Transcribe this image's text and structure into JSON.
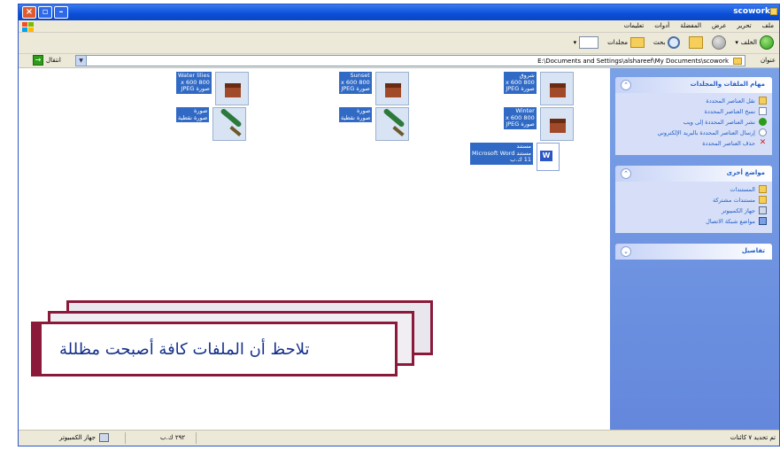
{
  "window": {
    "title": "scowork",
    "controls": {
      "close": "×",
      "maximize": "▫",
      "minimize": "–"
    }
  },
  "menubar": {
    "items": [
      "ملف",
      "تحرير",
      "عرض",
      "المفضلة",
      "أدوات",
      "تعليمات"
    ]
  },
  "toolbar": {
    "back_label": "الخلف",
    "search_label": "بحث",
    "folders_label": "مجلدات",
    "views_icon": "views-icon"
  },
  "addressbar": {
    "label": "عنوان",
    "path": "E:\\Documents and Settings\\alshareef\\My Documents\\scowork",
    "go_label": "انتقال"
  },
  "sidebar": {
    "file_tasks": {
      "title": "مهام الملفات والمجلدات",
      "items": [
        "نقل العناصر المحددة",
        "نسخ العناصر المحددة",
        "نشر العناصر المحددة إلى ويب",
        "إرسال العناصر المحددة بالبريد الإلكتروني",
        "حذف العناصر المحددة"
      ]
    },
    "other_places": {
      "title": "مواضع أخرى",
      "items": [
        "المستندات",
        "مستندات مشتركة",
        "جهاز الكمبيوتر",
        "مواضع شبكة الاتصال"
      ]
    },
    "details": {
      "title": "تفاصيل"
    }
  },
  "files": [
    {
      "label": "شروق\n800 x 600\nصورة JPEG",
      "type": "image"
    },
    {
      "label": "Sunset\n800 x 600\nصورة JPEG",
      "type": "image"
    },
    {
      "label": "Water lilies\n800 x 600\nصورة JPEG",
      "type": "image"
    },
    {
      "label": "صورة\nصورة نقطية",
      "type": "bitmap"
    },
    {
      "label": "صورة\nصورة نقطية",
      "type": "bitmap"
    },
    {
      "label": "Winter\n800 x 600\nصورة JPEG",
      "type": "image"
    },
    {
      "label": "مستند\nمستند Microsoft Word\n11 ك.ب",
      "type": "document"
    }
  ],
  "callout": {
    "text": "تلاحظ أن الملفات كافة أصبحت مظللة"
  },
  "statusbar": {
    "selection": "تم تحديد ٧ كائنات",
    "size": "٢٩٢ ك.ب",
    "location": "جهاز الكمبيوتر"
  }
}
